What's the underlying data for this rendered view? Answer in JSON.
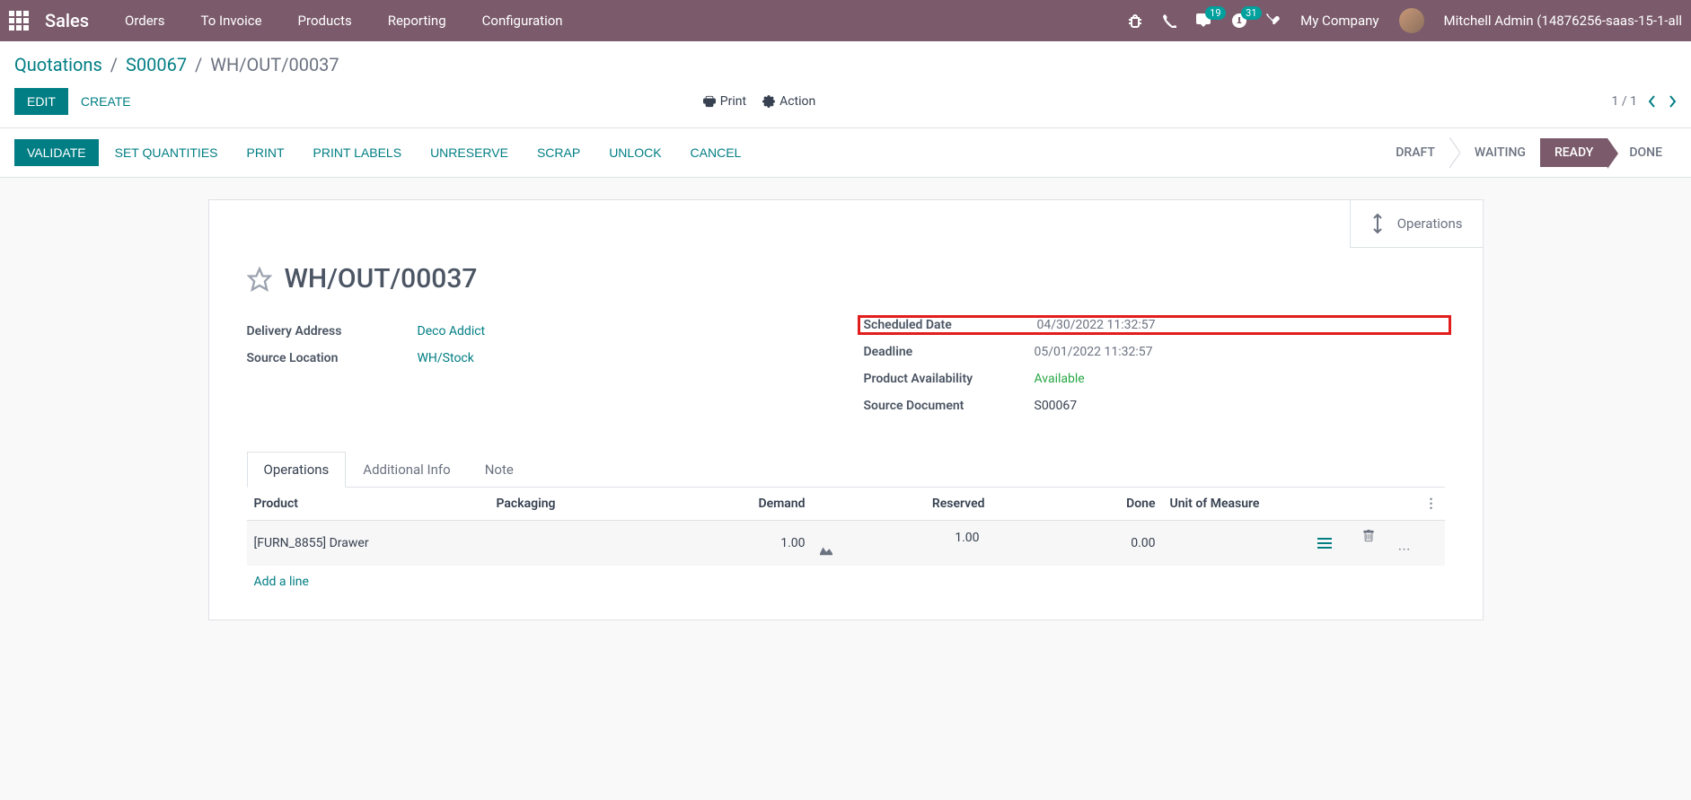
{
  "topbar": {
    "brand": "Sales",
    "nav": [
      "Orders",
      "To Invoice",
      "Products",
      "Reporting",
      "Configuration"
    ],
    "messages_count": "19",
    "activities_count": "31",
    "company": "My Company",
    "user": "Mitchell Admin (14876256-saas-15-1-all"
  },
  "breadcrumb": {
    "root": "Quotations",
    "parent": "S00067",
    "current": "WH/OUT/00037"
  },
  "controls": {
    "edit": "Edit",
    "create": "Create",
    "print": "Print",
    "action": "Action",
    "pager": "1 / 1"
  },
  "actions": {
    "validate": "Validate",
    "set_quantities": "Set Quantities",
    "print": "Print",
    "print_labels": "Print Labels",
    "unreserve": "Unreserve",
    "scrap": "Scrap",
    "unlock": "Unlock",
    "cancel": "Cancel"
  },
  "status": {
    "draft": "Draft",
    "waiting": "Waiting",
    "ready": "Ready",
    "done": "Done"
  },
  "stat": {
    "operations": "Operations"
  },
  "record": {
    "title": "WH/OUT/00037",
    "left": {
      "delivery_address_label": "Delivery Address",
      "delivery_address": "Deco Addict",
      "source_location_label": "Source Location",
      "source_location": "WH/Stock"
    },
    "right": {
      "scheduled_date_label": "Scheduled Date",
      "scheduled_date": "04/30/2022 11:32:57",
      "deadline_label": "Deadline",
      "deadline": "05/01/2022 11:32:57",
      "product_availability_label": "Product Availability",
      "product_availability": "Available",
      "source_document_label": "Source Document",
      "source_document": "S00067"
    }
  },
  "tabs": {
    "operations": "Operations",
    "additional": "Additional Info",
    "note": "Note"
  },
  "table": {
    "cols": {
      "product": "Product",
      "packaging": "Packaging",
      "demand": "Demand",
      "reserved": "Reserved",
      "done": "Done",
      "uom": "Unit of Measure"
    },
    "rows": [
      {
        "product": "[FURN_8855] Drawer",
        "packaging": "",
        "demand": "1.00",
        "reserved": "1.00",
        "done": "0.00",
        "uom": ""
      }
    ],
    "add_line": "Add a line"
  }
}
